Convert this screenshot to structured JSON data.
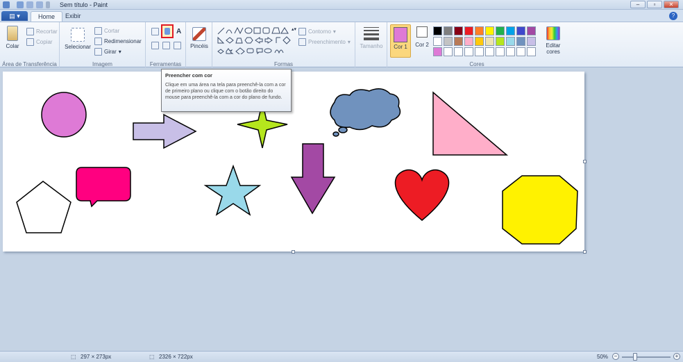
{
  "window": {
    "title": "Sem título - Paint"
  },
  "tabs": {
    "file": "▤ ▾",
    "home": "Home",
    "view": "Exibir"
  },
  "window_buttons": {
    "minimize": "–",
    "maximize": "▫",
    "close": "✕"
  },
  "help": "?",
  "ribbon": {
    "clipboard": {
      "label": "Área de Transferência",
      "paste": "Colar",
      "cut": "Recortar",
      "copy": "Copiar"
    },
    "image": {
      "label": "Imagem",
      "select": "Selecionar",
      "crop": "Cortar",
      "resize": "Redimensionar",
      "rotate": "Girar"
    },
    "tools": {
      "label": "Ferramentas"
    },
    "brushes": {
      "label": "Pincéis"
    },
    "shapes": {
      "label": "Formas",
      "outline": "Contorno",
      "fill": "Preenchimento"
    },
    "size": {
      "label": "Tamanho"
    },
    "colors": {
      "label": "Cores",
      "color1_label": "Cor 1",
      "color2_label": "Cor 2",
      "edit_label": "Editar cores",
      "color1": "#de7ad6",
      "color2": "#ffffff",
      "palette": [
        "#000000",
        "#7f7f7f",
        "#880015",
        "#ed1c24",
        "#ff7f27",
        "#fff200",
        "#22b14c",
        "#00a2e8",
        "#3f48cc",
        "#a349a4",
        "#ffffff",
        "#c3c3c3",
        "#b97a57",
        "#ffaec9",
        "#ffc90e",
        "#efe4b0",
        "#b5e61d",
        "#99d9ea",
        "#7092be",
        "#c8bfe7",
        "#de7ad6",
        "#ffffff",
        "#ffffff",
        "#ffffff",
        "#ffffff",
        "#ffffff",
        "#ffffff",
        "#ffffff",
        "#ffffff",
        "#ffffff"
      ]
    }
  },
  "tooltip": {
    "title": "Preencher com cor",
    "body": "Clique em uma área na tela para preenchê-la com a cor de primeiro plano ou clique com o botão direito do mouse para preenchê-la com a cor do plano de fundo."
  },
  "status": {
    "selection": "297 × 273px",
    "image_size": "2326 × 722px",
    "zoom": "50%"
  },
  "zoom_buttons": {
    "minus": "−",
    "plus": "+"
  },
  "canvas_colors": {
    "circle": "#de7ad6",
    "arrow_right": "#c8bfe7",
    "star4": "#b5e61d",
    "cloud": "#7092be",
    "triangle": "#ffaec9",
    "callout": "#ff0080",
    "pentagon": "#ffffff",
    "star5": "#99d9ea",
    "arrow_down": "#a349a4",
    "heart": "#ed1c24",
    "hexagon": "#fff200"
  }
}
